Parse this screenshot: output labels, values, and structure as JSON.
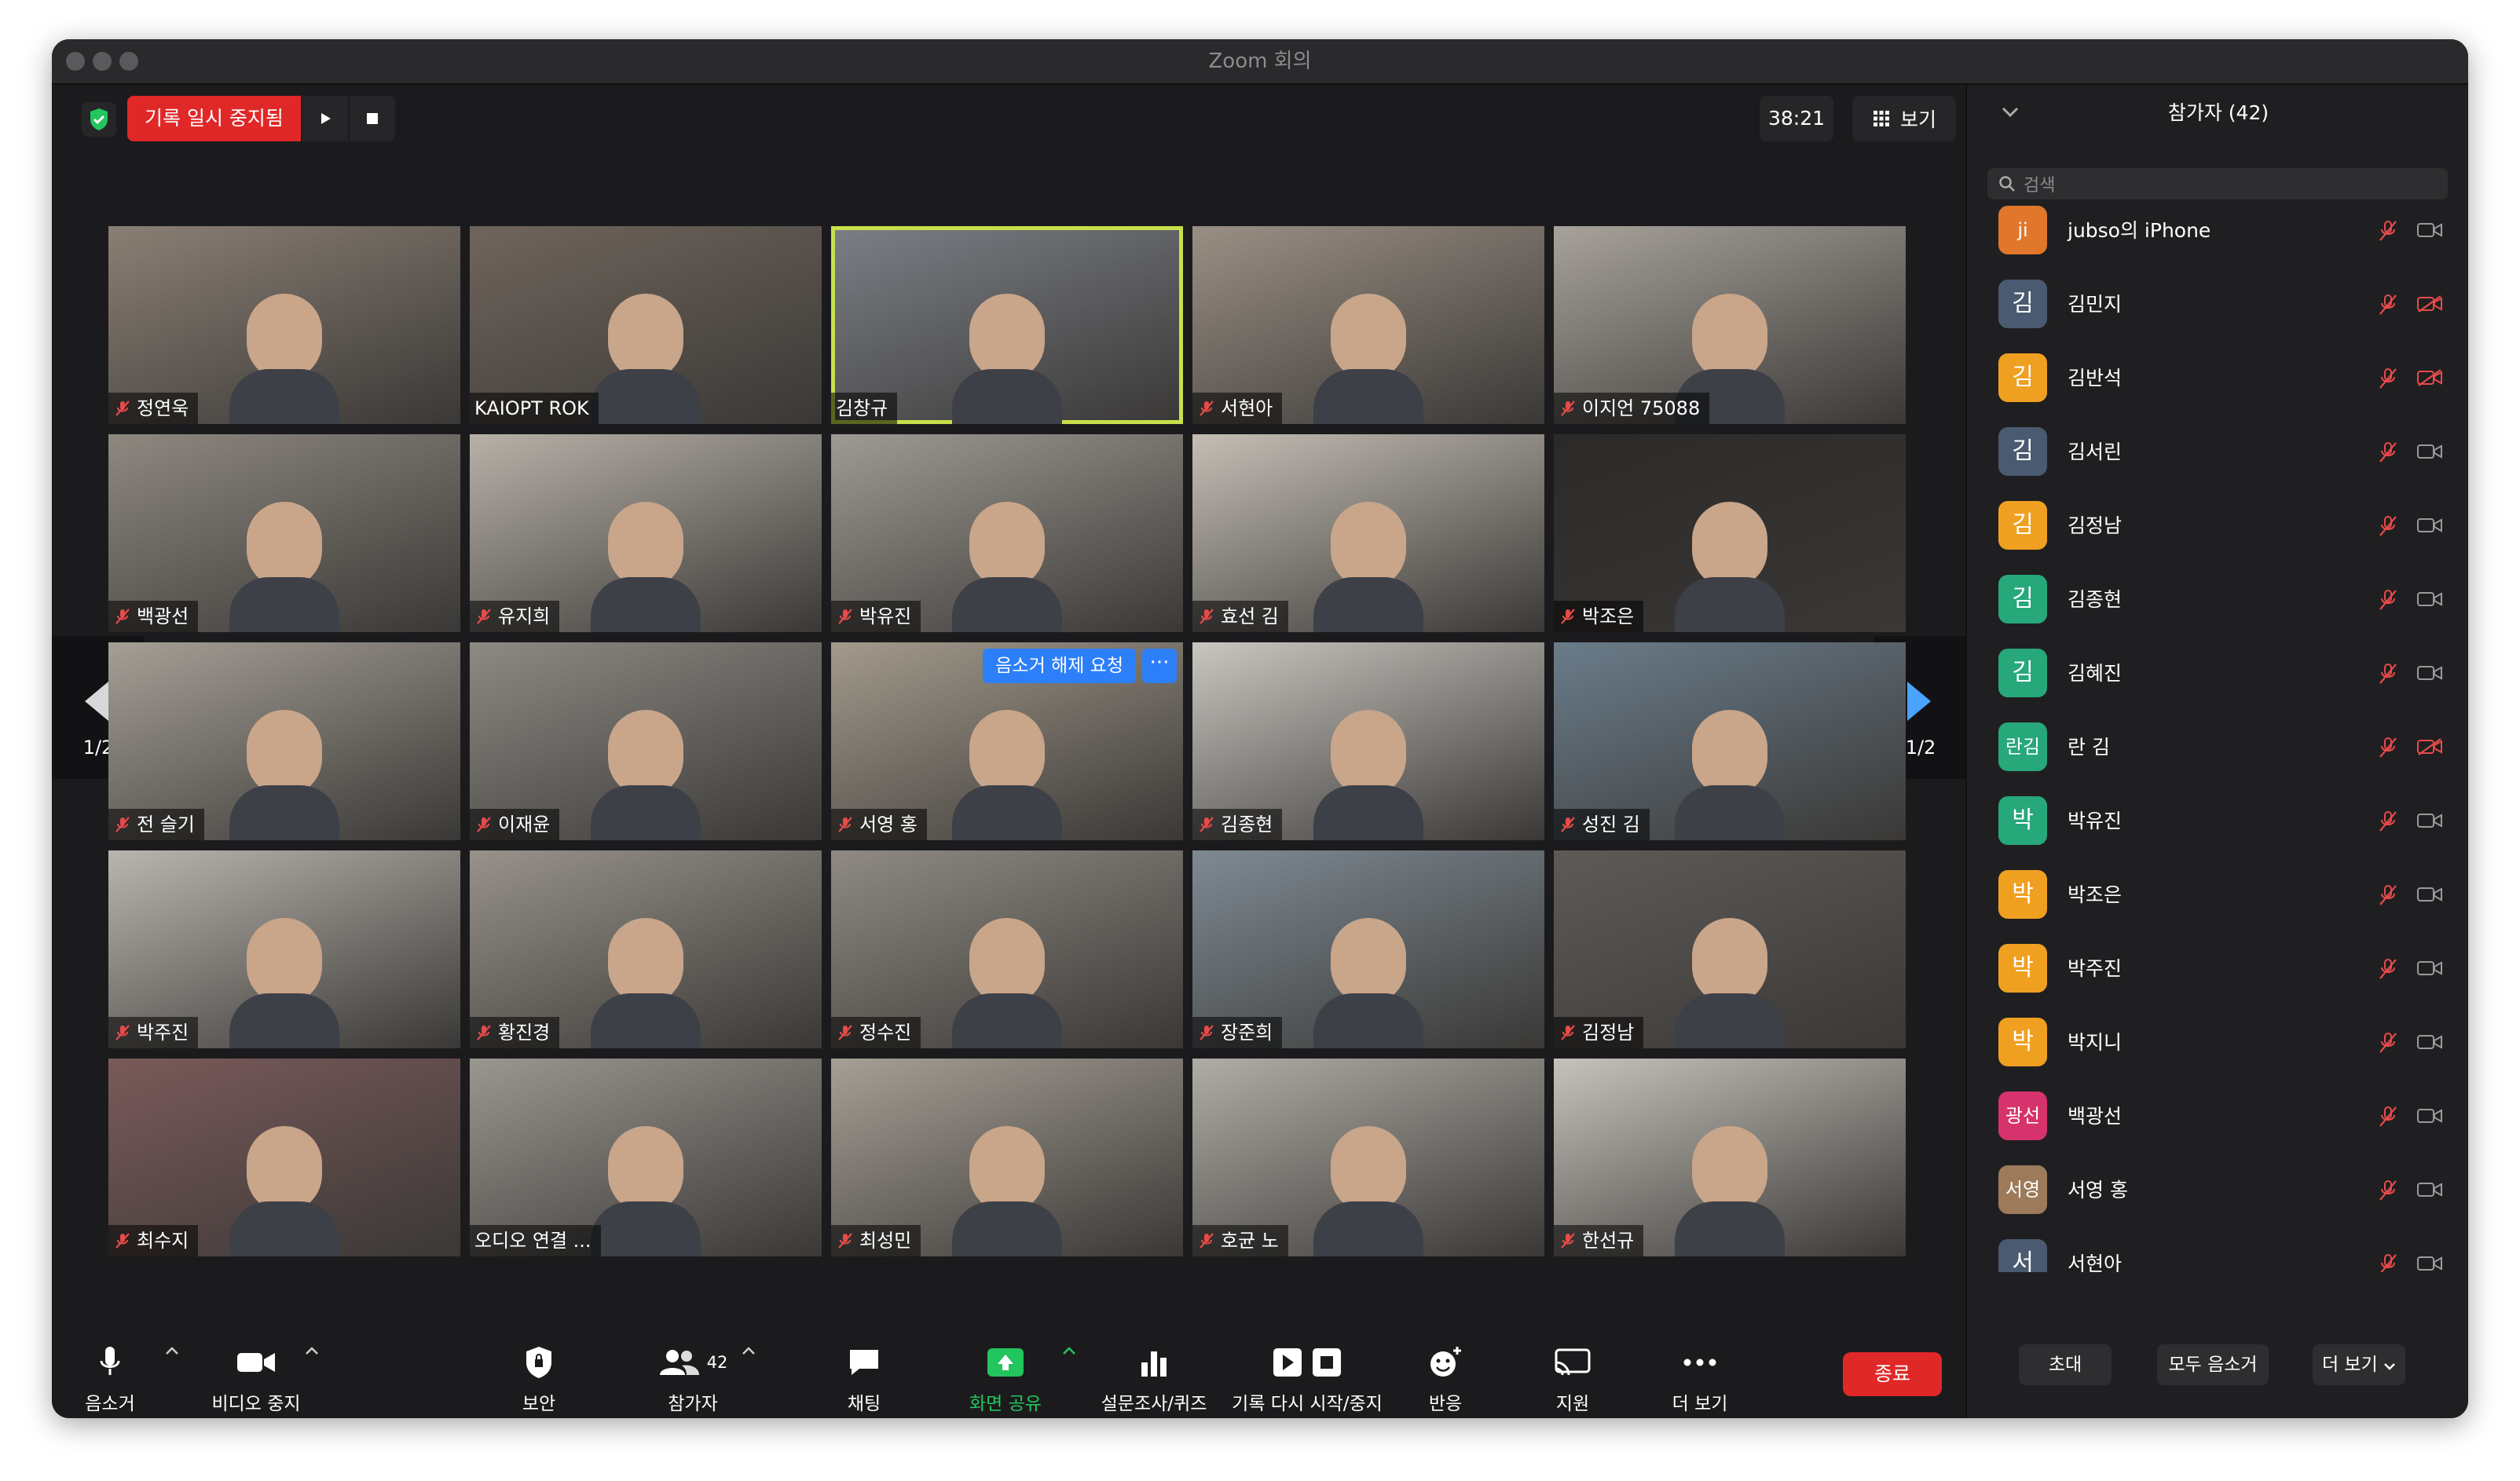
{
  "window": {
    "title": "Zoom 회의"
  },
  "top": {
    "recording_status": "기록 일시 중지됨",
    "timer": "38:21",
    "view_label": "보기"
  },
  "grid": {
    "page_indicator_left": "1/2",
    "page_indicator_right": "1/2",
    "unmute_request_label": "음소거 해제 요청",
    "more_label": "···",
    "tiles": [
      {
        "name": "정연욱",
        "muted": true
      },
      {
        "name": "KAIOPT ROK",
        "muted": false
      },
      {
        "name": "김창규",
        "muted": false,
        "active": true
      },
      {
        "name": "서현아",
        "muted": true
      },
      {
        "name": "이지언 75088",
        "muted": true
      },
      {
        "name": "백광선",
        "muted": true
      },
      {
        "name": "유지희",
        "muted": true
      },
      {
        "name": "박유진",
        "muted": true
      },
      {
        "name": "효선 김",
        "muted": true
      },
      {
        "name": "박조은",
        "muted": true
      },
      {
        "name": "전 슬기",
        "muted": true
      },
      {
        "name": "이재윤",
        "muted": true
      },
      {
        "name": "서영 홍",
        "muted": true
      },
      {
        "name": "김종현",
        "muted": true
      },
      {
        "name": "성진 김",
        "muted": true
      },
      {
        "name": "박주진",
        "muted": true
      },
      {
        "name": "황진경",
        "muted": true
      },
      {
        "name": "정수진",
        "muted": true
      },
      {
        "name": "장준희",
        "muted": true
      },
      {
        "name": "김정남",
        "muted": true
      },
      {
        "name": "최수지",
        "muted": true
      },
      {
        "name": "오디오 연결 ...",
        "muted": false
      },
      {
        "name": "최성민",
        "muted": true
      },
      {
        "name": "호균 노",
        "muted": true
      },
      {
        "name": "한선규",
        "muted": true
      }
    ]
  },
  "panel": {
    "title": "참가자 (42)",
    "search_placeholder": "검색",
    "participants": [
      {
        "initial": "ji",
        "name": "jubso의 iPhone",
        "color": "#e0772a",
        "cam_off": false
      },
      {
        "initial": "김",
        "name": "김민지",
        "color": "#4a5a70",
        "cam_off": true
      },
      {
        "initial": "김",
        "name": "김반석",
        "color": "#f0a020",
        "cam_off": true
      },
      {
        "initial": "김",
        "name": "김서린",
        "color": "#4a5a70",
        "cam_off": false
      },
      {
        "initial": "김",
        "name": "김정남",
        "color": "#f0a020",
        "cam_off": false
      },
      {
        "initial": "김",
        "name": "김종현",
        "color": "#26a87a",
        "cam_off": false
      },
      {
        "initial": "김",
        "name": "김혜진",
        "color": "#26a87a",
        "cam_off": false
      },
      {
        "initial": "란김",
        "name": "란 김",
        "color": "#26a87a",
        "cam_off": true
      },
      {
        "initial": "박",
        "name": "박유진",
        "color": "#26a87a",
        "cam_off": false
      },
      {
        "initial": "박",
        "name": "박조은",
        "color": "#f0a020",
        "cam_off": false
      },
      {
        "initial": "박",
        "name": "박주진",
        "color": "#f0a020",
        "cam_off": false
      },
      {
        "initial": "박",
        "name": "박지니",
        "color": "#f0a020",
        "cam_off": false
      },
      {
        "initial": "광선",
        "name": "백광선",
        "color": "#d6336c",
        "cam_off": false
      },
      {
        "initial": "서영",
        "name": "서영 홍",
        "color": "#9c7a5a",
        "cam_off": false
      },
      {
        "initial": "서",
        "name": "서현아",
        "color": "#4a5a70",
        "cam_off": false
      }
    ],
    "buttons": {
      "invite": "초대",
      "mute_all": "모두 음소거",
      "more": "더 보기"
    }
  },
  "toolbar": {
    "mute": "음소거",
    "video_stop": "비디오 중지",
    "security": "보안",
    "participants": "참가자",
    "participant_count": "42",
    "chat": "채팅",
    "share_screen": "화면 공유",
    "polls": "설문조사/퀴즈",
    "recording": "기록 다시 시작/중지",
    "reactions": "반응",
    "support": "지원",
    "more": "더 보기",
    "end": "종료"
  },
  "colors": {
    "accent_green": "#22c55e",
    "record_red": "#e02828",
    "request_blue": "#2d7ff9",
    "active_border": "#c9e04b"
  }
}
